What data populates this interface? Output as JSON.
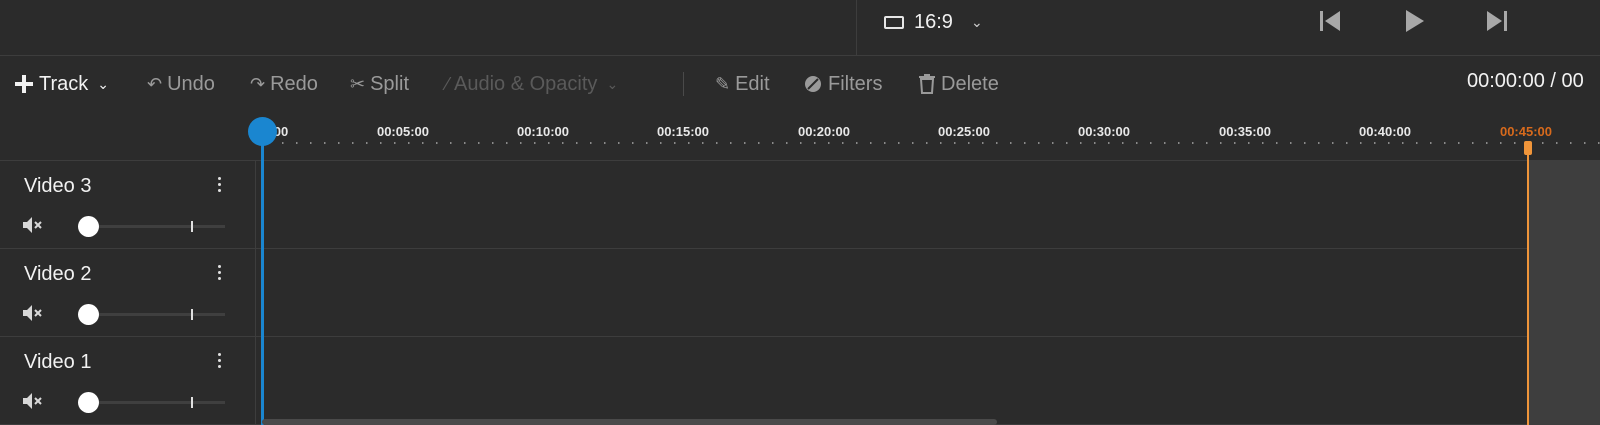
{
  "header": {
    "aspect_ratio": "16:9",
    "aspect_icon": "aspect-ratio-icon",
    "aspect_chevron": "⌄",
    "transport": [
      "skip-back-icon",
      "play-icon",
      "skip-forward-icon"
    ]
  },
  "toolbar": {
    "track_label": "Track",
    "track_chevron": "⌄",
    "undo_label": "Undo",
    "redo_label": "Redo",
    "split_label": "Split",
    "audio_opacity_label": "Audio & Opacity",
    "audio_opacity_chevron": "⌄",
    "edit_label": "Edit",
    "filters_label": "Filters",
    "delete_label": "Delete",
    "timecode": "00:00:00 / 00"
  },
  "ruler": {
    "ticks": [
      "00",
      "00:05:00",
      "00:10:00",
      "00:15:00",
      "00:20:00",
      "00:25:00",
      "00:30:00",
      "00:35:00",
      "00:40:00",
      "00:45:00"
    ],
    "end_time": "00:45:00",
    "end_color": "#d86a1c"
  },
  "tracks": [
    {
      "name": "Video 3",
      "muted": true
    },
    {
      "name": "Video 2",
      "muted": true
    },
    {
      "name": "Video 1",
      "muted": true
    }
  ],
  "colors": {
    "background": "#2b2b2b",
    "playhead": "#1a86d0",
    "end_marker": "#f0953a",
    "text": "#f2f2f2",
    "muted_text": "#9a9a9a",
    "disabled_text": "#5a5a5a"
  }
}
